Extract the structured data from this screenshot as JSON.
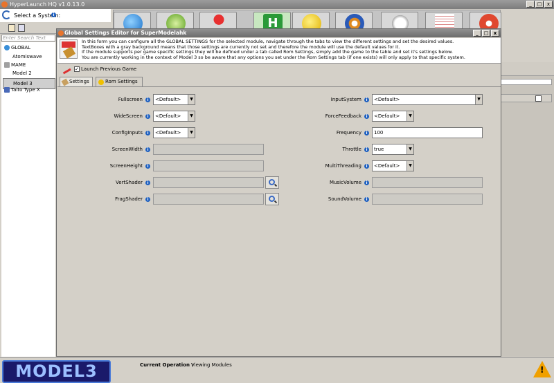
{
  "app": {
    "title": "HyperLaunch HQ v1.0.13.0"
  },
  "system_select": {
    "label": "Select a System:"
  },
  "search": {
    "placeholder": "Enter Search Text"
  },
  "tree": {
    "items": [
      {
        "label": "GLOBAL",
        "icon": "globe-icon"
      },
      {
        "label": "Atomiswave"
      },
      {
        "label": "MAME",
        "icon": "mame-icon"
      },
      {
        "label": "Model 2"
      },
      {
        "label": "Model 3",
        "selected": true
      },
      {
        "label": "Taito Type X",
        "icon": "taito-icon"
      }
    ]
  },
  "dialog": {
    "title": "Global Settings Editor for SuperModelahk",
    "info_lines": [
      "In this form you can configure all the GLOBAL SETTINGS for the selected module, navigate through the tabs to view the different settings and set the desired values.",
      "TextBoxes with a gray background means that those settings are currently not set and therefore the module will use the default values for it.",
      "If the module supports per game specific settings they will be defined under a tab called Rom Settings, simply add the game to the table and set it's settings below.",
      "You are currently working in the context of Model 3 so be aware that any options you set under the Rom Settings tab (if one exists) will only apply to that specific system."
    ],
    "launch_previous": "Launch Previous Game",
    "tabs": [
      {
        "label": "Settings"
      },
      {
        "label": "Rom Settings"
      }
    ],
    "left_fields": [
      {
        "label": "Fullscreen",
        "type": "select",
        "value": "<Default>"
      },
      {
        "label": "WideScreen",
        "type": "select",
        "value": "<Default>"
      },
      {
        "label": "ConfigInputs",
        "type": "select",
        "value": "<Default>"
      },
      {
        "label": "ScreenWidth",
        "type": "text",
        "value": ""
      },
      {
        "label": "ScreenHeight",
        "type": "text",
        "value": ""
      },
      {
        "label": "VertShader",
        "type": "file",
        "value": ""
      },
      {
        "label": "FragShader",
        "type": "file",
        "value": ""
      }
    ],
    "right_fields": [
      {
        "label": "InputSystem",
        "type": "select-wide",
        "value": "<Default>"
      },
      {
        "label": "ForceFeedback",
        "type": "select",
        "value": "<Default>"
      },
      {
        "label": "Frequency",
        "type": "text-white",
        "value": "100"
      },
      {
        "label": "Throttle",
        "type": "select",
        "value": "true"
      },
      {
        "label": "MultiThreading",
        "type": "select",
        "value": "<Default>"
      },
      {
        "label": "MusicVolume",
        "type": "text",
        "value": ""
      },
      {
        "label": "SoundVolume",
        "type": "text",
        "value": ""
      }
    ]
  },
  "status": {
    "logo": "MODEL3",
    "operation_label": "Current Operation :",
    "operation_value": "Viewing Modules"
  },
  "toolbar_icons": [
    "globe-icon",
    "gear-icon",
    "joystick-icon",
    "hyperlaunch-icon",
    "pacman-icon",
    "columns-icon",
    "gamepad-icon",
    "document-icon",
    "hyperspin-icon"
  ]
}
